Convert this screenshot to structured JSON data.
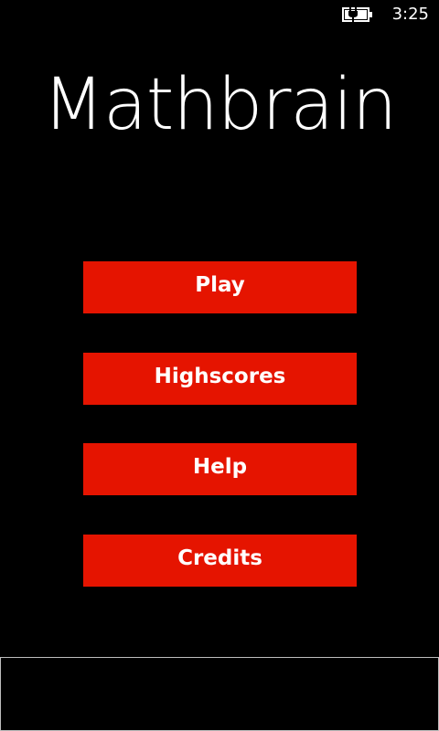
{
  "status_bar": {
    "battery_icon": "battery-charging-icon",
    "time": "3:25"
  },
  "app": {
    "title": "Mathbrain"
  },
  "menu": {
    "play_label": "Play",
    "highscores_label": "Highscores",
    "help_label": "Help",
    "credits_label": "Credits"
  },
  "colors": {
    "background": "#000000",
    "button_accent": "#e51400",
    "text": "#ffffff",
    "panel_border": "#bdbdbd"
  }
}
